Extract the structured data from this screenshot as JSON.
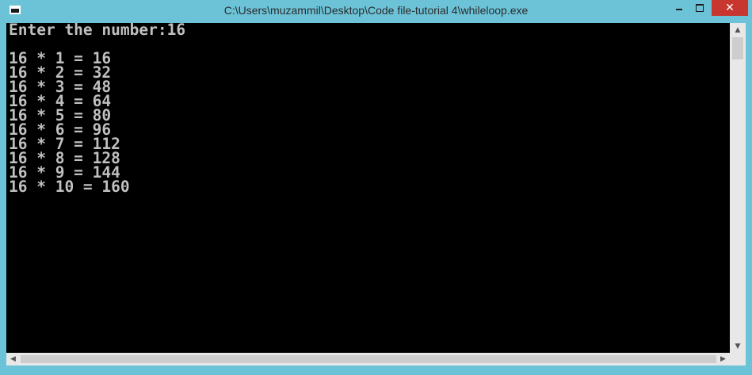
{
  "window": {
    "title": "C:\\Users\\muzammil\\Desktop\\Code file-tutorial 4\\whileloop.exe",
    "icon": "console-icon",
    "controls": {
      "minimize": "minimize-icon",
      "maximize": "maximize-icon",
      "close_label": "✕"
    },
    "frame_color": "#6cc3d8",
    "close_color": "#c7372f"
  },
  "console": {
    "background": "#000000",
    "text_color": "#c0c0c0",
    "lines": [
      "Enter the number:16",
      "",
      "16 * 1 = 16",
      "16 * 2 = 32",
      "16 * 3 = 48",
      "16 * 4 = 64",
      "16 * 5 = 80",
      "16 * 6 = 96",
      "16 * 7 = 112",
      "16 * 8 = 128",
      "16 * 9 = 144",
      "16 * 10 = 160"
    ]
  },
  "scrollbars": {
    "up_arrow": "▲",
    "down_arrow": "▼",
    "left_arrow": "◀",
    "right_arrow": "▶"
  }
}
